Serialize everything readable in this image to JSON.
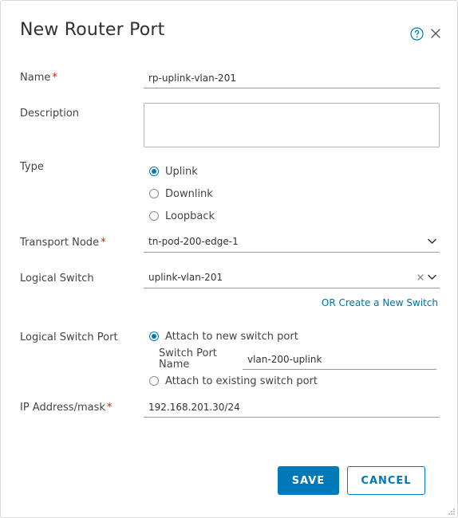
{
  "dialog": {
    "title": "New Router Port"
  },
  "icons": {
    "help": "help-circle-icon",
    "close": "close-icon"
  },
  "colors": {
    "accent": "#0079b8",
    "required": "#c92100",
    "link": "#0072a3"
  },
  "form": {
    "name": {
      "label": "Name",
      "required": "*",
      "value": "rp-uplink-vlan-201"
    },
    "description": {
      "label": "Description",
      "value": ""
    },
    "type": {
      "label": "Type",
      "options": [
        "Uplink",
        "Downlink",
        "Loopback"
      ],
      "selected": "Uplink"
    },
    "transport_node": {
      "label": "Transport Node",
      "required": "*",
      "value": "tn-pod-200-edge-1"
    },
    "logical_switch": {
      "label": "Logical Switch",
      "value": "uplink-vlan-201",
      "create_link": "OR Create a New Switch"
    },
    "logical_switch_port": {
      "label": "Logical Switch Port",
      "option_new": "Attach to new switch port",
      "option_existing": "Attach to existing switch port",
      "selected": "Attach to new switch port",
      "switch_port_name_label": "Switch Port Name",
      "switch_port_name_value": "vlan-200-uplink"
    },
    "ip_address": {
      "label": "IP Address/mask",
      "required": "*",
      "value": "192.168.201.30/24"
    }
  },
  "buttons": {
    "save": "SAVE",
    "cancel": "CANCEL"
  }
}
